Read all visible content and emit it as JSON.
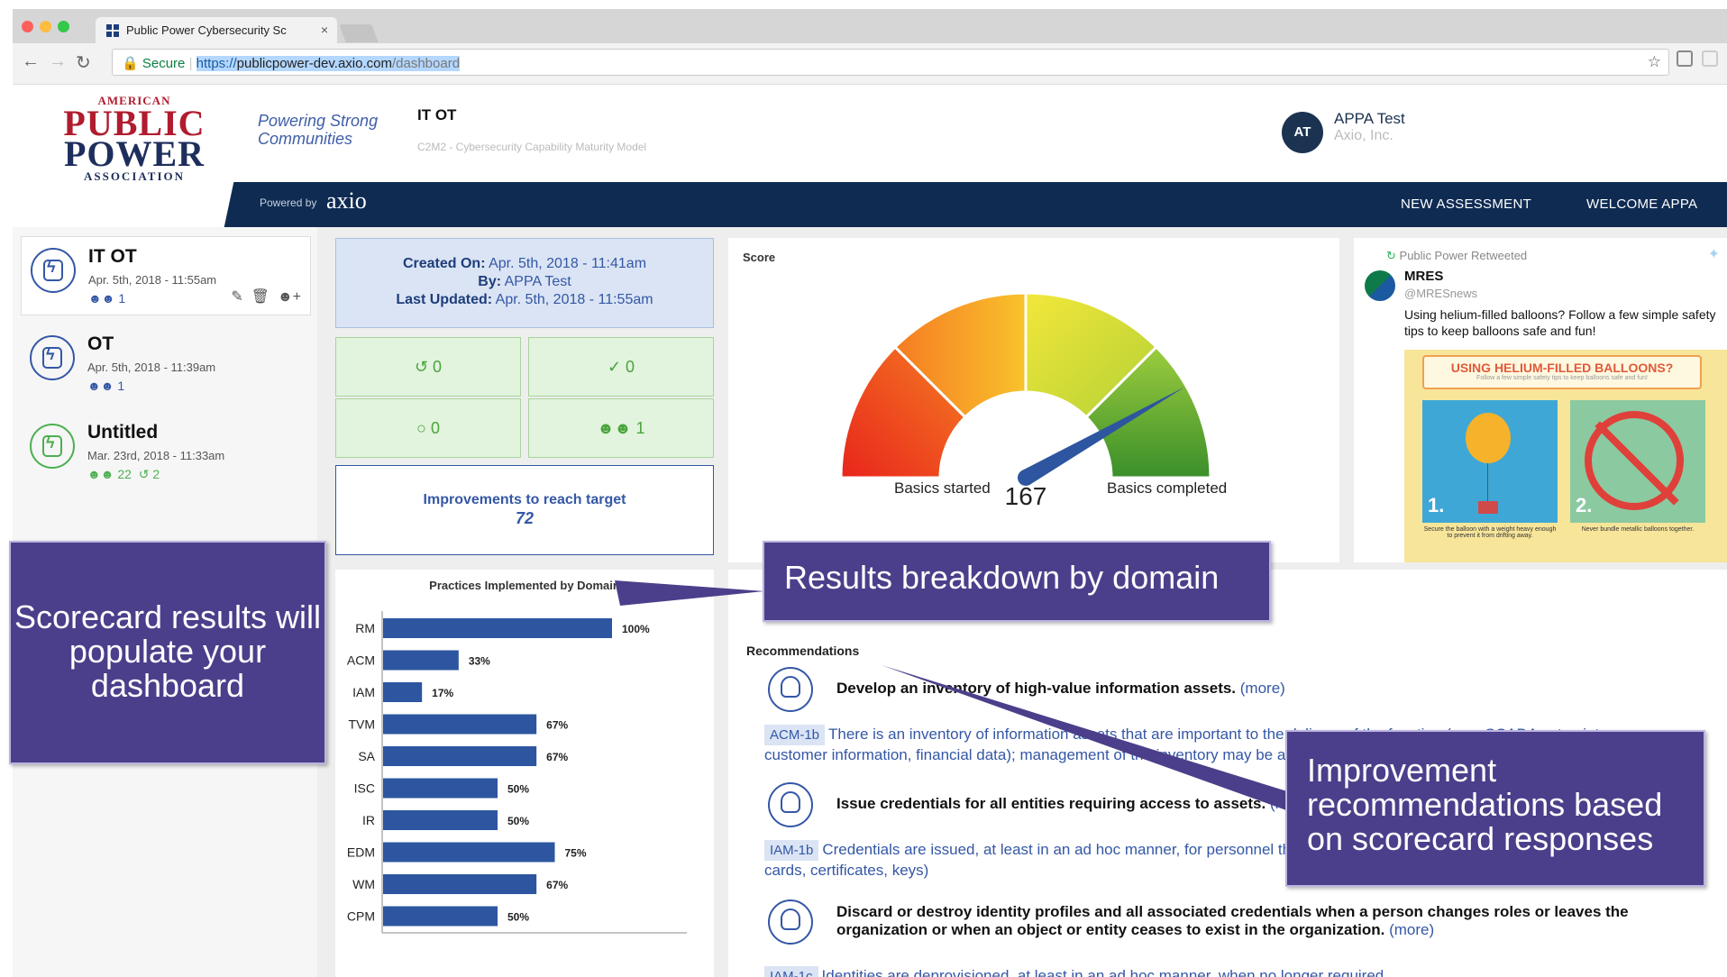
{
  "browser": {
    "tab_title": "Public Power Cybersecurity Sc",
    "secure_label": "Secure",
    "url_scheme": "https://",
    "url_host": "publicpower-dev.axio.com",
    "url_path": "/dashboard"
  },
  "header": {
    "logo": {
      "line1": "AMERICAN",
      "line2": "PUBLIC",
      "line3": "POWER",
      "line4": "ASSOCIATION"
    },
    "tagline": "Powering Strong Communities",
    "project_title": "IT OT",
    "project_subtitle": "C2M2 - Cybersecurity Capability Maturity Model",
    "user_initials": "AT",
    "user_name": "APPA Test",
    "user_org": "Axio, Inc.",
    "powered_by": "Powered by",
    "powered_brand": "axio",
    "nav": {
      "new_assessment": "NEW ASSESSMENT",
      "welcome": "WELCOME APPA"
    }
  },
  "sidebar": {
    "items": [
      {
        "name": "IT OT",
        "date": "Apr. 5th, 2018 - 11:55am",
        "meta": "1"
      },
      {
        "name": "OT",
        "date": "Apr. 5th, 2018 - 11:39am",
        "meta": "1"
      },
      {
        "name": "Untitled",
        "date": "Mar. 23rd, 2018 - 11:33am",
        "meta": "22",
        "meta2": "2"
      }
    ]
  },
  "info": {
    "created_label": "Created On:",
    "created_value": "Apr. 5th, 2018 - 11:41am",
    "by_label": "By:",
    "by_value": "APPA Test",
    "updated_label": "Last Updated:",
    "updated_value": "Apr. 5th, 2018 - 11:55am"
  },
  "stats": {
    "history": "0",
    "done": "0",
    "comments": "0",
    "users": "1"
  },
  "improvements": {
    "label": "Improvements to reach target",
    "value": "72"
  },
  "score": {
    "title": "Score",
    "value": 167,
    "max": 200,
    "left_label": "Basics started",
    "right_label": "Basics completed"
  },
  "twitter": {
    "retweet_label": "Public Power Retweeted",
    "author": "MRES",
    "handle": "@MRESnews",
    "text": "Using helium-filled balloons? Follow a few simple safety tips to keep balloons safe and fun!",
    "image_title": "USING HELIUM-FILLED BALLOONS?",
    "image_subtitle": "Follow a few simple safety tips to keep balloons safe and fun!",
    "step1": "1.",
    "step2": "2.",
    "caption1": "Secure the balloon with a weight heavy enough to prevent it from drifting away.",
    "caption2": "Never bundle metallic balloons together."
  },
  "chart_data": {
    "type": "bar",
    "title": "Practices Implemented by Domain",
    "categories": [
      "RM",
      "ACM",
      "IAM",
      "TVM",
      "SA",
      "ISC",
      "IR",
      "EDM",
      "WM",
      "CPM"
    ],
    "values": [
      100,
      33,
      17,
      67,
      67,
      50,
      50,
      75,
      67,
      50
    ],
    "value_suffix": "%",
    "xlim": [
      0,
      100
    ],
    "orientation": "horizontal",
    "bar_color": "#2d55a0"
  },
  "recommendations": {
    "title": "Recommendations",
    "more": "(more)",
    "items": [
      {
        "heading": "Develop an inventory of high-value information assets.",
        "code": "ACM-1b",
        "detail": "There is an inventory of information assets that are important to the delivery of the function (e.g., SCADA set points, customer information, financial data); management of the inventory may be ad hoc"
      },
      {
        "heading": "Issue credentials for all entities requiring access to assets.",
        "code": "IAM-1b",
        "detail": "Credentials are issued, at least in an ad hoc manner, for personnel that require access to assets (e.g., passwords, smart cards, certificates, keys)"
      },
      {
        "heading": "Discard or destroy identity profiles and all associated credentials when a person changes roles or leaves the organization or when an object or entity ceases to exist in the organization.",
        "code": "IAM-1c",
        "detail": "Identities are deprovisioned, at least in an ad hoc manner, when no longer required"
      }
    ]
  },
  "callouts": {
    "scorecard": "Scorecard results will populate your dashboard",
    "breakdown": "Results breakdown by domain",
    "improvement": "Improvement recommendations based on scorecard responses"
  },
  "colors": {
    "navy": "#0f2b52",
    "accent": "#3457a6",
    "callout": "#4b3f8b",
    "green": "#4aa53c",
    "brand_red": "#b01c2e"
  }
}
